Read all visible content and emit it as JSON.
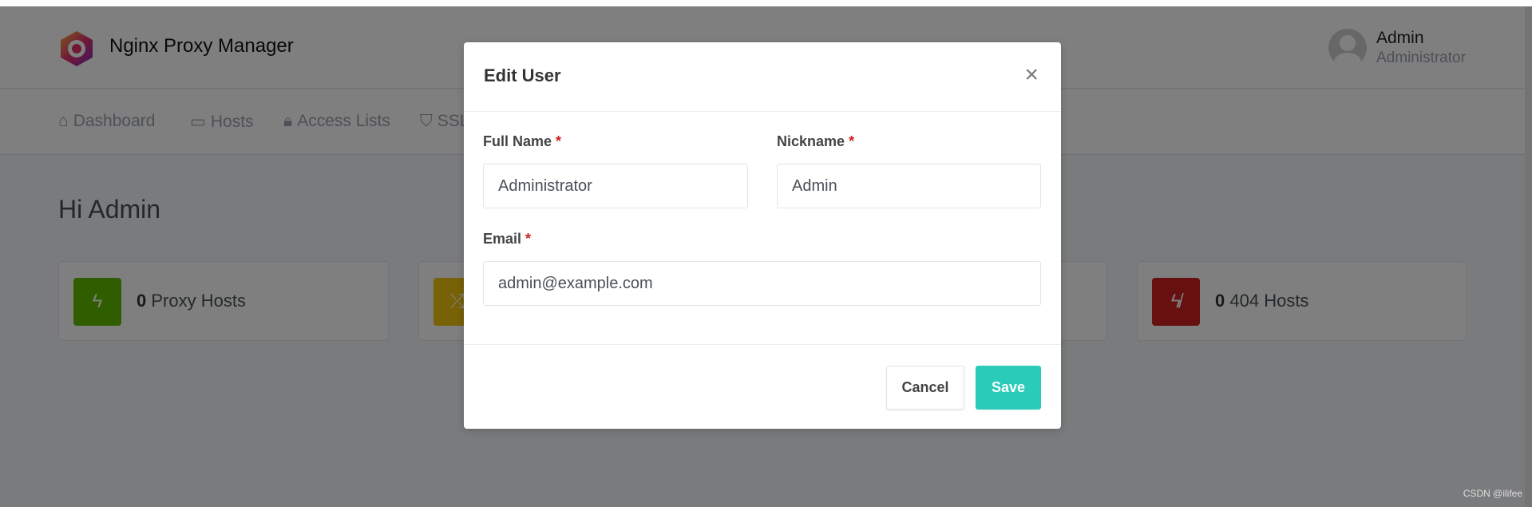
{
  "app": {
    "brand": "Nginx Proxy Manager"
  },
  "user": {
    "name": "Admin",
    "role": "Administrator"
  },
  "nav": [
    {
      "label": "Dashboard",
      "icon": "home-icon"
    },
    {
      "label": "Hosts",
      "icon": "monitor-icon"
    },
    {
      "label": "Access Lists",
      "icon": "lock-icon"
    },
    {
      "label": "SSL",
      "icon": "shield-icon"
    }
  ],
  "greeting": "Hi Admin",
  "cards": [
    {
      "count": "0",
      "label": "Proxy Hosts",
      "color": "#5eba00",
      "icon": "zap-icon"
    },
    {
      "color": "#f1c40f",
      "icon": "shuffle-icon"
    },
    {
      "count": "0",
      "label": "404 Hosts",
      "color": "#cd201f",
      "icon": "zap-off-icon"
    }
  ],
  "modal": {
    "title": "Edit User",
    "full_name_label": "Full Name",
    "full_name": "Administrator",
    "nickname_label": "Nickname",
    "nickname": "Admin",
    "email_label": "Email",
    "email": "admin@example.com",
    "required": "*",
    "cancel": "Cancel",
    "save": "Save"
  },
  "watermark": "CSDN @ilifee"
}
